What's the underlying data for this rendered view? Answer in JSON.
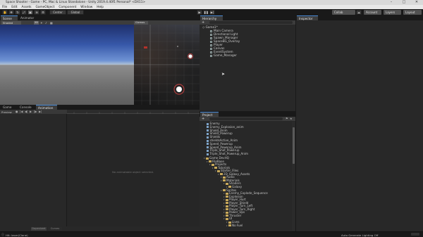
{
  "window": {
    "title": "Space Shooter - Game - PC, Mac & Linux Standalone - Unity 2019.4.40f1 Personal* <DX11>"
  },
  "menu": [
    "File",
    "Edit",
    "Assets",
    "GameObject",
    "Component",
    "Window",
    "Help"
  ],
  "toolbar": {
    "center_label": "Center",
    "global_label": "Global",
    "play_icon": "play-icon",
    "pause_icon": "pause-icon",
    "step_icon": "step-icon",
    "account_label": "Account",
    "layers_label": "Layers",
    "layout_label": "Layout",
    "collab_label": "Collab"
  },
  "scene_panel": {
    "tabs": [
      "Scene",
      "Animator"
    ],
    "shading_label": "Shaded",
    "twod_label": "2D",
    "gizmos_label": "Gizmos"
  },
  "hierarchy": {
    "tab": "Hierarchy",
    "scene_name": "Game1*",
    "items": [
      "Main Camera",
      "Directional Light",
      "Spawn_Manager",
      "SpaceBG_Overlay",
      "Player",
      "Canvas",
      "EventSystem",
      "Game_Manager"
    ]
  },
  "inspector": {
    "tab": "Inspector"
  },
  "animation": {
    "tabs": [
      "Game",
      "Console",
      "Animation"
    ],
    "preview_label": "Preview",
    "empty_message": "No animatable object selected.",
    "bottom_tabs": [
      "Dopesheet",
      "Curves"
    ]
  },
  "project": {
    "tab": "Project",
    "create_label": "+",
    "top_items": [
      "Enemy",
      "Enemy_Explosion_anim",
      "Shield_Anim",
      "Shield_Powerup",
      "Shields",
      "shieldsActive_Anim",
      "Speed_Powerup",
      "Speed_Powerup_Anim",
      "Triple_Shot_Powerup",
      "Triple_Shot_Powerup_Anim"
    ],
    "tree": [
      {
        "label": "Game DevHQ",
        "depth": 0
      },
      {
        "label": "FileBase",
        "depth": 1
      },
      {
        "label": "Projects",
        "depth": 2
      },
      {
        "label": "Tutorials",
        "depth": 3
      },
      {
        "label": "Starter_Files",
        "depth": 4
      },
      {
        "label": "2D_Galaxy_Assets",
        "depth": 5
      },
      {
        "label": "Audio",
        "depth": 6
      },
      {
        "label": "Materials",
        "depth": 6
      },
      {
        "label": "Shaders",
        "depth": 7
      },
      {
        "label": "Galaxy",
        "depth": 8
      },
      {
        "label": "Sprites",
        "depth": 6
      },
      {
        "label": "Enemy_Explode_Sequence",
        "depth": 7
      },
      {
        "label": "Explosion",
        "depth": 7
      },
      {
        "label": "Player_Hurt",
        "depth": 7
      },
      {
        "label": "Player_Shield",
        "depth": 7
      },
      {
        "label": "Player_Turn_Left",
        "depth": 7
      },
      {
        "label": "Player_Turn_Right",
        "depth": 7
      },
      {
        "label": "Power_Ups",
        "depth": 7
      },
      {
        "label": "Thruster",
        "depth": 7
      },
      {
        "label": "UI",
        "depth": 7
      },
      {
        "label": "Lives",
        "depth": 8
      },
      {
        "label": "No Fuel",
        "depth": 8
      }
    ]
  },
  "status": {
    "left": "Hit: laser(Clone)",
    "right": "Auto Generate Lighting Off"
  }
}
